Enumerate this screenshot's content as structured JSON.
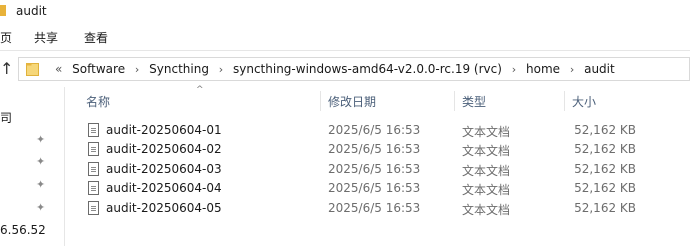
{
  "window": {
    "title": "audit"
  },
  "ribbon": {
    "tabs": [
      "页",
      "共享",
      "查看"
    ]
  },
  "address": {
    "prefix": "«",
    "crumbs": [
      "Software",
      "Syncthing",
      "syncthing-windows-amd64-v2.0.0-rc.19 (rvc)",
      "home",
      "audit"
    ]
  },
  "nav": {
    "frag_top": "司",
    "frag_bottom": "6.56.52"
  },
  "columns": {
    "name": "名称",
    "date": "修改日期",
    "type": "类型",
    "size": "大小"
  },
  "files": [
    {
      "name": "audit-20250604-01",
      "date": "2025/6/5 16:53",
      "type": "文本文档",
      "size": "52,162 KB"
    },
    {
      "name": "audit-20250604-02",
      "date": "2025/6/5 16:53",
      "type": "文本文档",
      "size": "52,162 KB"
    },
    {
      "name": "audit-20250604-03",
      "date": "2025/6/5 16:53",
      "type": "文本文档",
      "size": "52,162 KB"
    },
    {
      "name": "audit-20250604-04",
      "date": "2025/6/5 16:53",
      "type": "文本文档",
      "size": "52,162 KB"
    },
    {
      "name": "audit-20250604-05",
      "date": "2025/6/5 16:53",
      "type": "文本文档",
      "size": "52,162 KB"
    }
  ]
}
